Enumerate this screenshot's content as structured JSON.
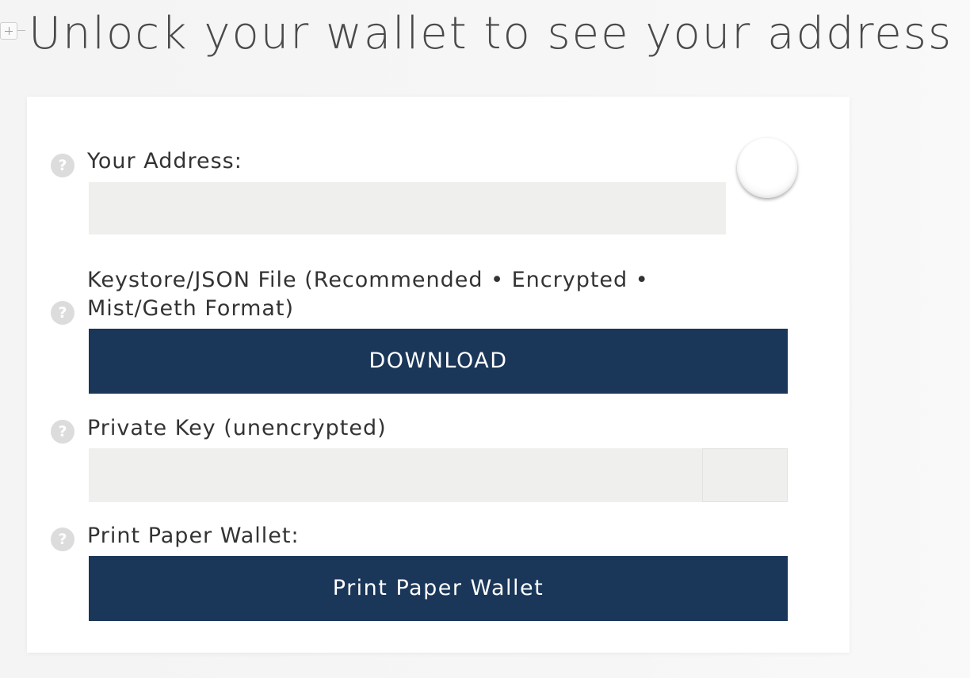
{
  "header": {
    "title": "Unlock your wallet to see your address"
  },
  "address": {
    "label": "Your Address:",
    "value": ""
  },
  "keystore": {
    "label_line1": "Keystore/JSON File (Recommended • Encrypted •",
    "label_line2": "Mist/Geth Format)",
    "button_label": "DOWNLOAD"
  },
  "private_key": {
    "label": "Private Key (unencrypted)",
    "value": ""
  },
  "paper_wallet": {
    "label": "Print Paper Wallet:",
    "button_label": "Print Paper Wallet"
  },
  "help_glyph": "?",
  "colors": {
    "button_bg": "#1a3659",
    "input_bg": "#efefed",
    "help_icon": "#dcdcdc"
  }
}
